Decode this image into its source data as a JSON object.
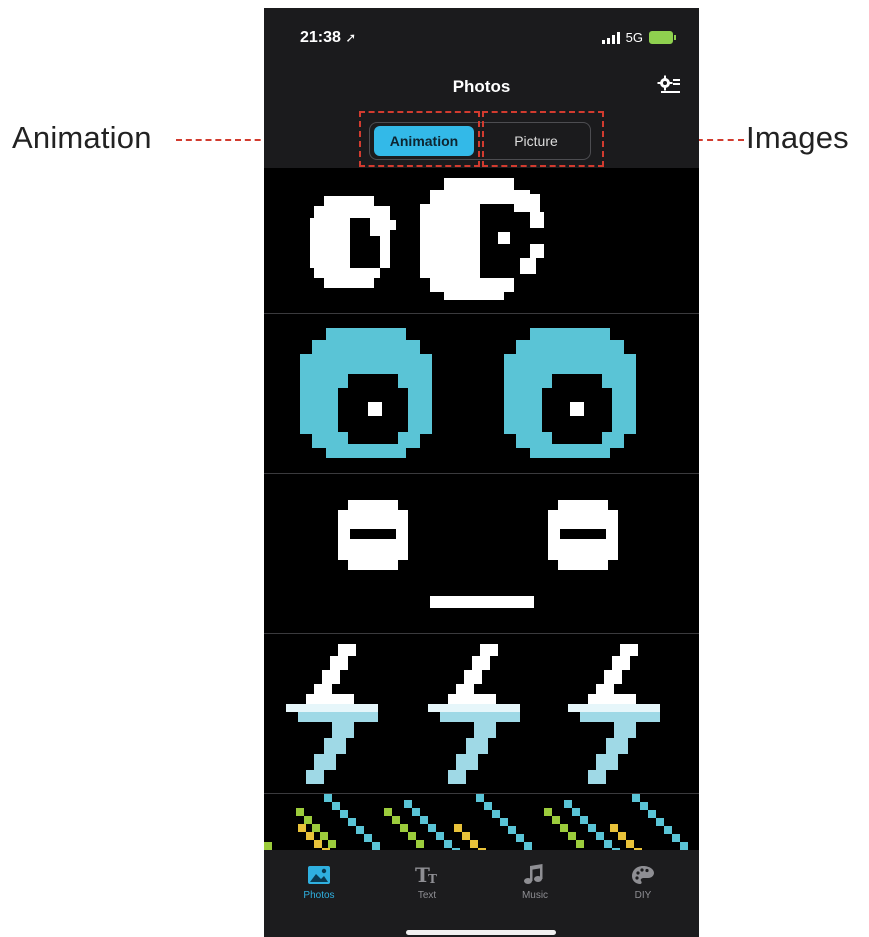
{
  "annotations": {
    "left_label": "Animation",
    "right_label": "Images"
  },
  "status_bar": {
    "time": "21:38",
    "network": "5G"
  },
  "nav": {
    "title": "Photos"
  },
  "segmented": {
    "animation_label": "Animation",
    "picture_label": "Picture",
    "selected": "Animation"
  },
  "tabs": [
    {
      "label": "Photos",
      "icon": "photos-icon",
      "active": true
    },
    {
      "label": "Text",
      "icon": "text-icon",
      "active": false
    },
    {
      "label": "Music",
      "icon": "music-icon",
      "active": false
    },
    {
      "label": "DIY",
      "icon": "palette-icon",
      "active": false
    }
  ],
  "colors": {
    "accent": "#33b9e8",
    "annotation": "#d23b2f",
    "eye_cyan": "#5ac4d6",
    "bolt_light": "#9fd9e6",
    "stripe_green": "#9ccc3c",
    "stripe_yellow": "#e8c23a"
  },
  "animations": [
    {
      "name": "white-eyes"
    },
    {
      "name": "cyan-eyes"
    },
    {
      "name": "sleepy-face"
    },
    {
      "name": "lightning-bolts"
    },
    {
      "name": "stripes"
    }
  ]
}
